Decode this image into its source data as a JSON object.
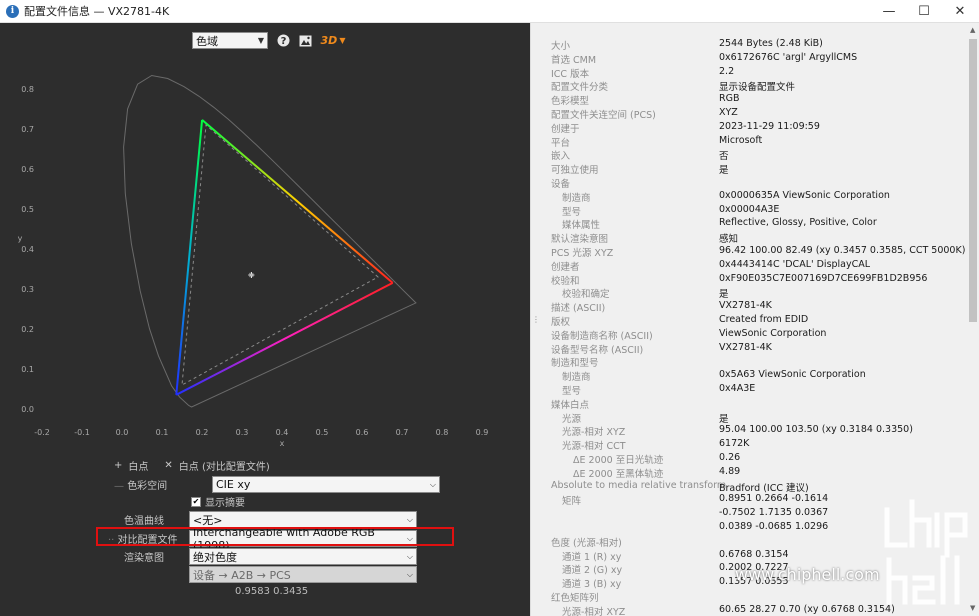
{
  "window": {
    "title": "配置文件信息 — VX2781-4K",
    "app_icon_glyph": "i",
    "controls": {
      "minimize": "—",
      "maximize": "☐",
      "close": "✕"
    }
  },
  "toolbar": {
    "view_select": "色域",
    "help_icon": "help-icon",
    "image_icon": "image-icon",
    "threed_label": "3D"
  },
  "plot": {
    "xlabel": "x",
    "ylabel": "y",
    "xticks": [
      "-0.2",
      "-0.1",
      "0.0",
      "0.1",
      "0.2",
      "0.3",
      "0.4",
      "0.5",
      "0.6",
      "0.7",
      "0.8",
      "0.9"
    ],
    "yticks": [
      "0.0",
      "0.1",
      "0.2",
      "0.3",
      "0.4",
      "0.5",
      "0.6",
      "0.7",
      "0.8"
    ],
    "primaries": {
      "red": [
        0.6768,
        0.3154
      ],
      "green": [
        0.2002,
        0.7227
      ],
      "blue": [
        0.1357,
        0.0355
      ]
    },
    "compare_primaries": {
      "red": [
        0.64,
        0.33
      ],
      "green": [
        0.21,
        0.71
      ],
      "blue": [
        0.15,
        0.06
      ]
    },
    "whitepoint": [
      0.3184,
      0.335
    ]
  },
  "controls": {
    "whitepoint_label": "白点",
    "whitepoint_compare_label": "白点 (对比配置文件)",
    "colorspace_label": "色彩空间",
    "colorspace_value": "CIE xy",
    "show_outline_label": "显示摘要",
    "curve_label": "色温曲线",
    "curve_value": "<无>",
    "compare_profile_label": "对比配置文件",
    "compare_profile_value": "Interchangeable with Adobe RGB (1998)",
    "intent_label": "渲染意图",
    "intent_value": "绝对色度",
    "direction_value": "设备 → A2B → PCS",
    "coords": "0.9583 0.3435"
  },
  "info": [
    {
      "k": "大小",
      "v": "2544 Bytes (2.48 KiB)",
      "indent": 0
    },
    {
      "k": "首选 CMM",
      "v": "0x6172676C 'argl' ArgyllCMS",
      "indent": 0
    },
    {
      "k": "ICC 版本",
      "v": "2.2",
      "indent": 0
    },
    {
      "k": "配置文件分类",
      "v": "显示设备配置文件",
      "indent": 0
    },
    {
      "k": "色彩模型",
      "v": "RGB",
      "indent": 0
    },
    {
      "k": "配置文件关连空间 (PCS)",
      "v": "XYZ",
      "indent": 0
    },
    {
      "k": "创建于",
      "v": "2023-11-29 11:09:59",
      "indent": 0
    },
    {
      "k": "平台",
      "v": "Microsoft",
      "indent": 0
    },
    {
      "k": "嵌入",
      "v": "否",
      "indent": 0
    },
    {
      "k": "可独立使用",
      "v": "是",
      "indent": 0
    },
    {
      "k": "设备",
      "v": "",
      "indent": 0
    },
    {
      "k": "制造商",
      "v": "0x0000635A ViewSonic Corporation",
      "indent": 1
    },
    {
      "k": "型号",
      "v": "0x00004A3E",
      "indent": 1
    },
    {
      "k": "媒体属性",
      "v": "Reflective, Glossy, Positive, Color",
      "indent": 1
    },
    {
      "k": "默认渲染意图",
      "v": "感知",
      "indent": 0
    },
    {
      "k": "PCS 光源 XYZ",
      "v": "96.42 100.00  82.49 (xy 0.3457 0.3585, CCT 5000K)",
      "indent": 0
    },
    {
      "k": "创建者",
      "v": "0x4443414C 'DCAL' DisplayCAL",
      "indent": 0
    },
    {
      "k": "校验和",
      "v": "0xF90E035C7E007169D7CE699FB1D2B956",
      "indent": 0
    },
    {
      "k": "校验和确定",
      "v": "是",
      "indent": 1
    },
    {
      "k": "描述 (ASCII)",
      "v": "VX2781-4K",
      "indent": 0
    },
    {
      "k": "版权",
      "v": "Created from EDID",
      "indent": 0
    },
    {
      "k": "设备制造商名称 (ASCII)",
      "v": "ViewSonic Corporation",
      "indent": 0
    },
    {
      "k": "设备型号名称 (ASCII)",
      "v": "VX2781-4K",
      "indent": 0
    },
    {
      "k": "制造和型号",
      "v": "",
      "indent": 0
    },
    {
      "k": "制造商",
      "v": "0x5A63 ViewSonic Corporation",
      "indent": 1
    },
    {
      "k": "型号",
      "v": "0x4A3E",
      "indent": 1
    },
    {
      "k": "媒体白点",
      "v": "",
      "indent": 0
    },
    {
      "k": "光源",
      "v": "是",
      "indent": 1
    },
    {
      "k": "光源-相对 XYZ",
      "v": "95.04 100.00 103.50 (xy 0.3184 0.3350)",
      "indent": 1
    },
    {
      "k": "光源-相对 CCT",
      "v": "6172K",
      "indent": 1
    },
    {
      "k": "ΔE 2000 至日光轨迹",
      "v": "0.26",
      "indent": 2
    },
    {
      "k": "ΔE 2000 至黑体轨迹",
      "v": "4.89",
      "indent": 2
    },
    {
      "k": "Absolute to media relative transform",
      "v": "Bradford (ICC 建议)",
      "indent": 0
    },
    {
      "k": "矩阵",
      "v": "0.8951 0.2664 -0.1614",
      "indent": 1
    },
    {
      "k": "",
      "v": "-0.7502 1.7135 0.0367",
      "indent": 1
    },
    {
      "k": "",
      "v": "0.0389 -0.0685 1.0296",
      "indent": 1
    },
    {
      "k": "色度 (光源-相对)",
      "v": "",
      "indent": 0
    },
    {
      "k": "通道 1 (R) xy",
      "v": "0.6768 0.3154",
      "indent": 1
    },
    {
      "k": "通道 2 (G) xy",
      "v": "0.2002 0.7227",
      "indent": 1
    },
    {
      "k": "通道 3 (B) xy",
      "v": "0.1357 0.0355",
      "indent": 1
    },
    {
      "k": "红色矩阵列",
      "v": "",
      "indent": 0
    },
    {
      "k": "光源-相对 XYZ",
      "v": "60.65  28.27   0.70 (xy 0.6768 0.3154)",
      "indent": 1
    }
  ],
  "watermark": {
    "text": "www.chiphell.com",
    "logo": "chip hell"
  },
  "colors": {
    "dark_panel": "#2d2d2d",
    "highlight": "#e01010",
    "label_gray": "#8e8e8e"
  }
}
